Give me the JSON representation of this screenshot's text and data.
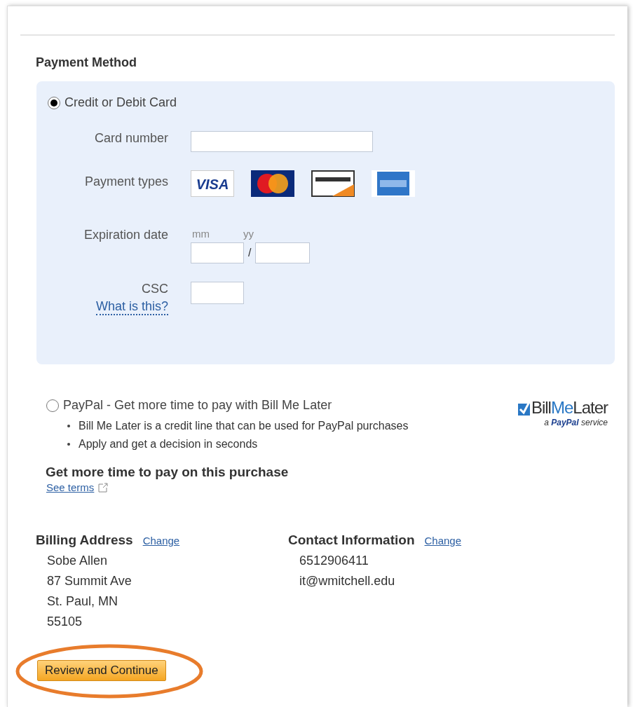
{
  "section_title": "Payment Method",
  "card_option": {
    "label": "Credit or Debit Card",
    "selected": true,
    "card_number_label": "Card number",
    "payment_types_label": "Payment types",
    "payment_types": [
      {
        "kind": "visa",
        "label": "VISA"
      },
      {
        "kind": "mastercard"
      },
      {
        "kind": "discover"
      },
      {
        "kind": "amex"
      }
    ],
    "expiration_label": "Expiration date",
    "month_placeholder": "mm",
    "year_placeholder": "yy",
    "separator": "/",
    "csc_label": "CSC",
    "csc_help": "What is this?"
  },
  "paypal_option": {
    "label": "PayPal - Get more time to pay with Bill Me Later",
    "selected": false,
    "bullets": [
      "Bill Me Later is a credit line that can be used for PayPal purchases",
      "Apply and get a decision in seconds"
    ],
    "headline": "Get more time to pay on this purchase",
    "terms_link": "See terms",
    "logo": {
      "name_1": "Bill",
      "name_2": "Me",
      "name_3": "Later",
      "tagline_1": "a",
      "tagline_2": "PayPal",
      "tagline_3": "service"
    }
  },
  "billing": {
    "title": "Billing Address",
    "change": "Change",
    "lines": [
      "Sobe Allen",
      "87 Summit Ave",
      "St. Paul, MN",
      "55105"
    ]
  },
  "contact": {
    "title": "Contact Information",
    "change": "Change",
    "lines": [
      "6512906411",
      "it@wmitchell.edu"
    ]
  },
  "continue_button": "Review and Continue"
}
